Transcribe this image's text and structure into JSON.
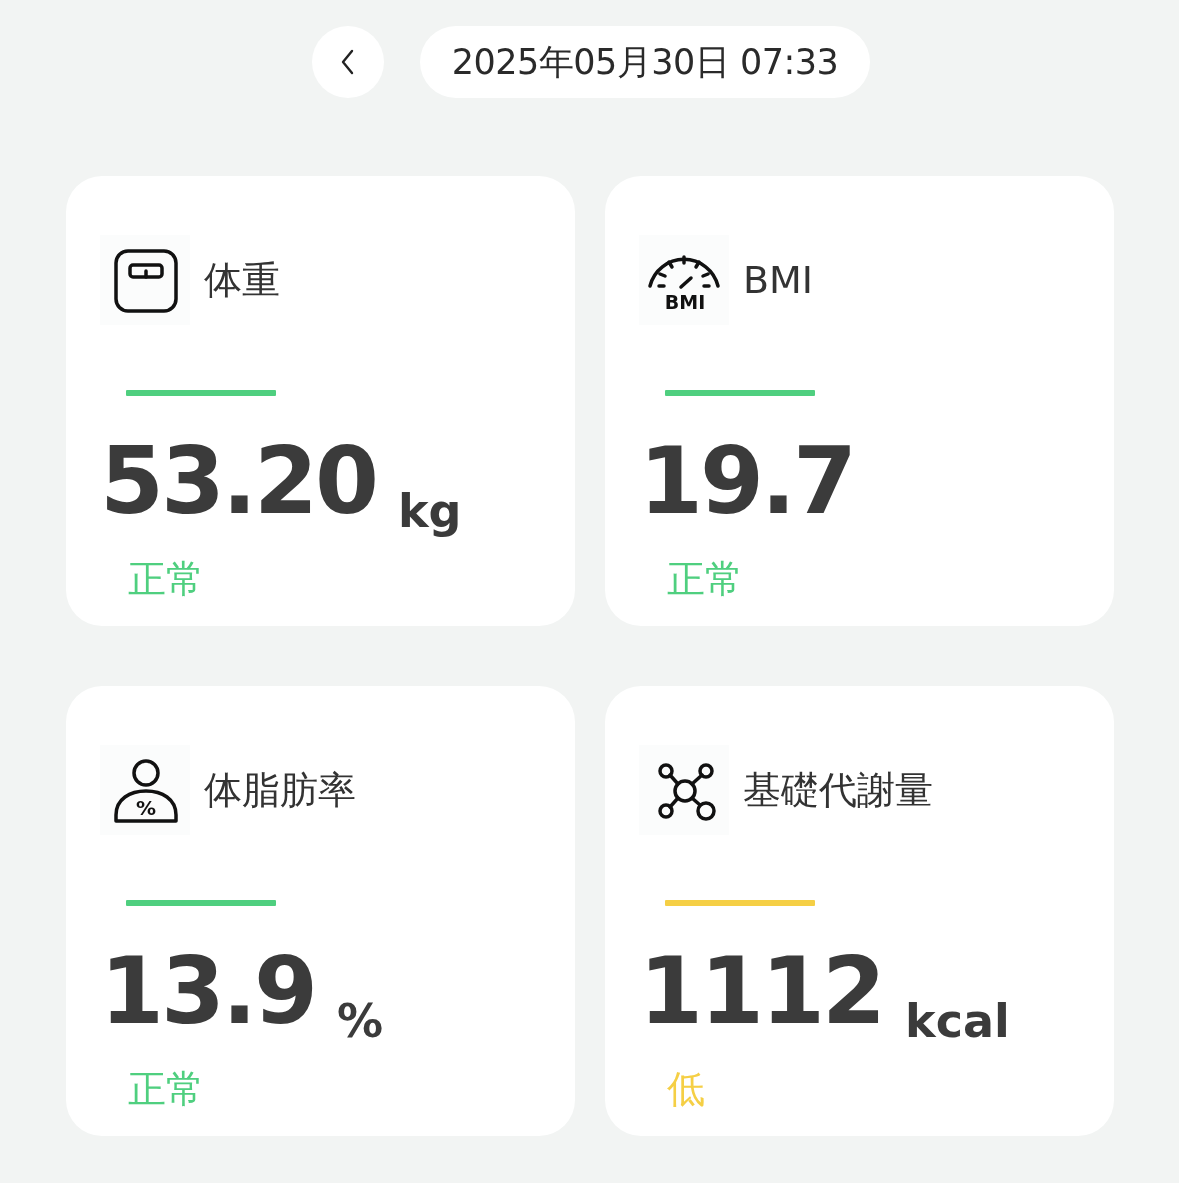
{
  "header": {
    "datetime": "2025年05月30日 07:33"
  },
  "cards": [
    {
      "kind": "weight",
      "label": "体重",
      "value": "53.20",
      "unit": "kg",
      "status": "正常",
      "color": "#4fcf7f"
    },
    {
      "kind": "bmi",
      "icon_text": "BMI",
      "label": "BMI",
      "value": "19.7",
      "status": "正常",
      "color": "#4fcf7f"
    },
    {
      "kind": "body_fat",
      "icon_text": "%",
      "label": "体脂肪率",
      "value": "13.9",
      "unit": "%",
      "status": "正常",
      "color": "#4fcf7f"
    },
    {
      "kind": "bmr",
      "label": "基礎代謝量",
      "value": "1112",
      "unit": "kcal",
      "status": "低",
      "color": "#f5cf45"
    }
  ]
}
